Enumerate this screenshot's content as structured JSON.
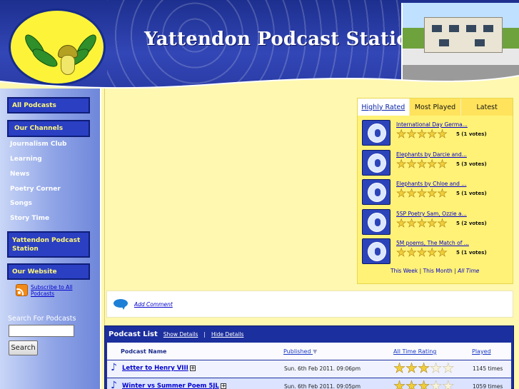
{
  "header": {
    "title": "Yattendon Podcast Station"
  },
  "sidebar": {
    "all_podcasts": "All Podcasts",
    "our_channels": "Our Channels",
    "channels": [
      "Journalism Club",
      "Learning",
      "News",
      "Poetry Corner",
      "Songs",
      "Story Time"
    ],
    "station": "Yattendon Podcast Station",
    "our_website": "Our Website",
    "subscribe": "Subscribe to All Podcasts",
    "search_label": "Search For Podcasts",
    "search_value": "",
    "search_button": "Search"
  },
  "top_podcasts": {
    "tabs": [
      "Highly Rated",
      "Most Played",
      "Latest"
    ],
    "active_tab": "Highly Rated",
    "items": [
      {
        "title": "International Day Germa...",
        "rating": 5,
        "votes": "5 (1 votes)"
      },
      {
        "title": "Elephants by Darcie and...",
        "rating": 5,
        "votes": "5 (3 votes)"
      },
      {
        "title": "Elephants by Chloe and ...",
        "rating": 5,
        "votes": "5 (1 votes)"
      },
      {
        "title": "5SP Poetry Sam, Ozzie a...",
        "rating": 5,
        "votes": "5 (2 votes)"
      },
      {
        "title": "5M poems, The Match of ...",
        "rating": 5,
        "votes": "5 (1 votes)"
      }
    ],
    "periods": [
      "This Week",
      "This Month",
      "All Time"
    ],
    "period_sep": "|",
    "active_period": "All Time"
  },
  "comments": {
    "add_comment": "Add Comment"
  },
  "podcast_list": {
    "title": "Podcast List",
    "show_details": "Show Details",
    "sep": "|",
    "hide_details": "Hide Details",
    "columns": {
      "name": "Podcast Name",
      "published": "Published",
      "rating": "All Time Rating",
      "played": "Played"
    },
    "rows": [
      {
        "name": "Letter to Henry VIII",
        "published": "Sun. 6th Feb 2011. 09:06pm",
        "rating": 3,
        "played": "1145 times"
      },
      {
        "name": "Winter vs Summer Poem 5JL",
        "published": "Sun. 6th Feb 2011. 09:05pm",
        "rating": 3,
        "played": "1059 times"
      }
    ]
  },
  "icons": {
    "note": "music-note-icon",
    "expand": "plus-box-icon",
    "star_full": "★",
    "star_empty": "☆",
    "sort_arrow": "▼",
    "note_glyph": "♪",
    "expand_glyph": "+"
  },
  "colors": {
    "header_blue": "#2a3ca6",
    "sidebar_box": "#2a3fc2",
    "sidebar_text": "#fff77a",
    "main_bg": "#fff8b0",
    "widget_bg": "#fff277",
    "link": "#0000cc",
    "star": "#f0ce3a"
  }
}
